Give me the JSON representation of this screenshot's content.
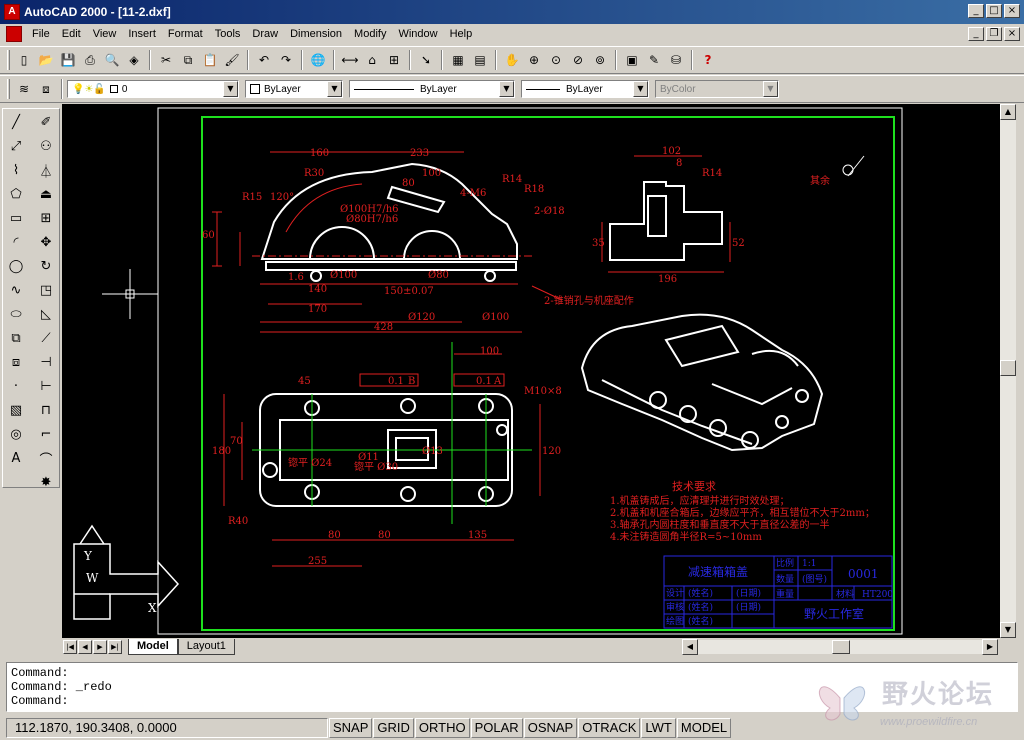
{
  "window": {
    "title": "AutoCAD 2000 - [11-2.dxf]",
    "min": "_",
    "max": "□",
    "close": "×",
    "restore": "❐"
  },
  "menu": [
    "File",
    "Edit",
    "View",
    "Insert",
    "Format",
    "Tools",
    "Draw",
    "Dimension",
    "Modify",
    "Window",
    "Help"
  ],
  "properties": {
    "layer_value": "0",
    "color_value": "ByLayer",
    "linetype_value": "ByLayer",
    "lineweight_value": "ByLayer",
    "plotstyle_value": "ByColor"
  },
  "tabs": {
    "model": "Model",
    "layout1": "Layout1"
  },
  "command_lines": [
    "Command:",
    "Command: _redo",
    "Command:"
  ],
  "status": {
    "coords": "112.1870, 190.3408, 0.0000",
    "toggles": [
      "SNAP",
      "GRID",
      "ORTHO",
      "POLAR",
      "OSNAP",
      "OTRACK",
      "LWT",
      "MODEL"
    ]
  },
  "watermark": {
    "title": "野火论坛",
    "url": "www.proewildfire.cn"
  },
  "drawing": {
    "dims_top": [
      "160",
      "233",
      "100",
      "80",
      "R15",
      "R30",
      "R18",
      "R14",
      "4-M6",
      "2-Ø18",
      "120°",
      "60",
      "1.6"
    ],
    "dims_mid": [
      "Ø100",
      "Ø80",
      "150±0.07",
      "Ø120",
      "Ø100",
      "170",
      "428",
      "140"
    ],
    "callout": "2-锥销孔与机座配作",
    "fit1": "Ø100H7/h6",
    "fit2": "Ø80H7/h6",
    "side_dims": [
      "102",
      "8",
      "R14",
      "196",
      "35",
      "52"
    ],
    "roughness": "其余",
    "plan_dims": [
      "100",
      "45",
      "0.1",
      "B",
      "0.1",
      "A",
      "M10×8",
      "180",
      "70",
      "120",
      "R40",
      "80",
      "80",
      "135",
      "255"
    ],
    "plan_labels": [
      "锪平 Ø24",
      "Ø11",
      "锪平 Ø30",
      "Ø13"
    ],
    "tech_title": "技术要求",
    "tech_lines": [
      "1.机盖铸成后，应清理并进行时效处理；",
      "2.机盖和机座合箱后，边缘应平齐，相互错位不大于2mm；",
      "3.轴承孔内圆柱度和垂直度不大于直径公差的一半",
      "4.未注铸造圆角半径R=5~10mm"
    ],
    "titleblock": {
      "name": "减速箱箱盖",
      "number": "0001",
      "material": "HT200",
      "company": "野火工作室",
      "cells": [
        "比例",
        "1:1",
        "数量",
        "(图号)",
        "设计",
        "(姓名)",
        "(日期)",
        "审核",
        "(姓名)",
        "(日期)",
        "绘图",
        "(姓名)",
        "重量",
        "材料"
      ]
    }
  }
}
